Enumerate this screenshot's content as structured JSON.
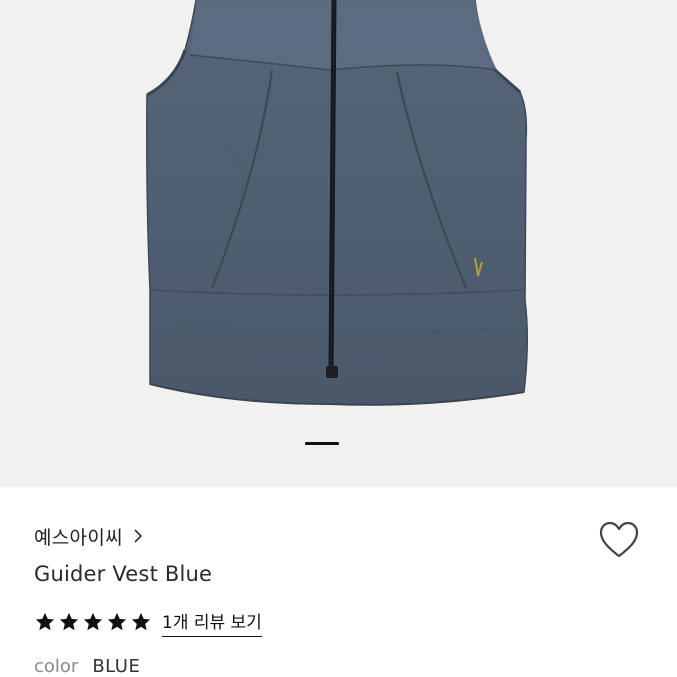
{
  "product": {
    "brand": "예스아이씨",
    "title": "Guider Vest Blue",
    "review_link": "1개 리뷰 보기",
    "rating_stars": 5,
    "color_label": "color",
    "color_value": "BLUE"
  },
  "gallery": {
    "active_index": 0,
    "background": "#f1f1f1",
    "vest_color": "#4f5d6f"
  },
  "icons": {
    "wishlist": "heart-outline-icon",
    "brand_link": "chevron-right-icon",
    "rating": "star-icon"
  }
}
